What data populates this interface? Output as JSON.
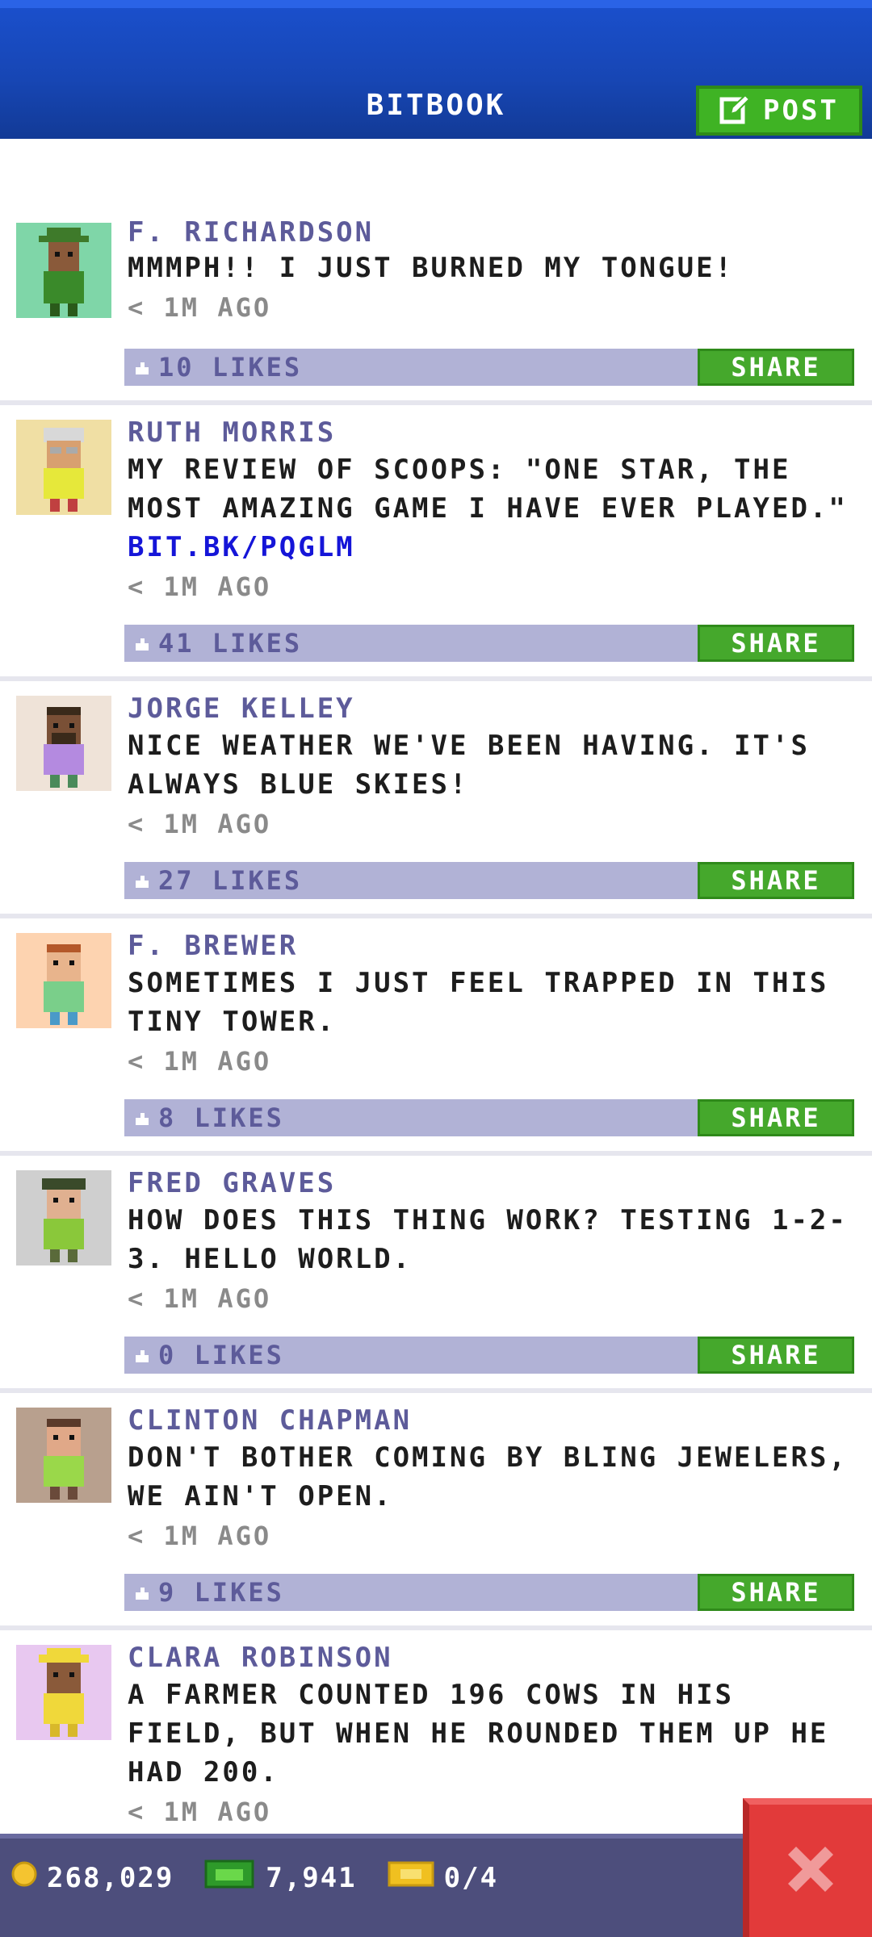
{
  "header": {
    "title": "BITBOOK",
    "post_label": "POST"
  },
  "posts": [
    {
      "name": "F. RICHARDSON",
      "message": "MMMPH!! I JUST BURNED MY TONGUE!",
      "link": "",
      "time": "< 1M AGO",
      "likes": "10 LIKES",
      "share": "SHARE",
      "avatar_bg": "#7fd6a8",
      "skin": "#8a5a3a",
      "shirt": "#3a8a2a",
      "hat": "#3e7a2a"
    },
    {
      "name": "RUTH MORRIS",
      "message": "MY REVIEW OF SCOOPS: \"ONE STAR, THE MOST AMAZING GAME I HAVE EVER PLAYED.\"",
      "link": "BIT.BK/PQGLM",
      "time": "< 1M AGO",
      "likes": "41 LIKES",
      "share": "SHARE",
      "avatar_bg": "#f0dfa4",
      "skin": "#d8a070",
      "shirt": "#e6e83a",
      "hat": "#d8d8d8"
    },
    {
      "name": "JORGE KELLEY",
      "message": "NICE WEATHER WE'VE BEEN HAVING. IT'S ALWAYS BLUE SKIES!",
      "link": "",
      "time": "< 1M AGO",
      "likes": "27 LIKES",
      "share": "SHARE",
      "avatar_bg": "#efe3d8",
      "skin": "#7a5036",
      "shirt": "#b48ae0",
      "hat": "#3a2a1a"
    },
    {
      "name": "F. BREWER",
      "message": "SOMETIMES I JUST FEEL TRAPPED IN THIS TINY TOWER.",
      "link": "",
      "time": "< 1M AGO",
      "likes": "8 LIKES",
      "share": "SHARE",
      "avatar_bg": "#fdd3b0",
      "skin": "#e8b48c",
      "shirt": "#7acf8a",
      "hat": "#b4582a"
    },
    {
      "name": "FRED GRAVES",
      "message": "HOW DOES THIS THING WORK? TESTING 1-2-3. HELLO WORLD.",
      "link": "",
      "time": "< 1M AGO",
      "likes": "0 LIKES",
      "share": "SHARE",
      "avatar_bg": "#cfcfcf",
      "skin": "#e0b090",
      "shirt": "#8ac83a",
      "hat": "#3a4a2a"
    },
    {
      "name": "CLINTON CHAPMAN",
      "message": "DON'T BOTHER COMING BY BLING JEWELERS, WE AIN'T OPEN.",
      "link": "",
      "time": "< 1M AGO",
      "likes": "9 LIKES",
      "share": "SHARE",
      "avatar_bg": "#b8a08e",
      "skin": "#e0a888",
      "shirt": "#9ad84a",
      "hat": "#5a3a2a"
    },
    {
      "name": "CLARA ROBINSON",
      "message": "A FARMER COUNTED 196 COWS IN HIS FIELD, BUT WHEN HE ROUNDED THEM UP HE HAD 200.",
      "link": "",
      "time": "< 1M AGO",
      "likes": "",
      "share": "",
      "avatar_bg": "#e8c8f0",
      "skin": "#8a5a3a",
      "shirt": "#f0d83a",
      "hat": "#f0d83a"
    }
  ],
  "status": {
    "coins": "268,029",
    "bux": "7,941",
    "tickets": "0/4"
  },
  "colors": {
    "header_blue": "#1746b4",
    "post_green": "#3fb324",
    "like_bar": "#b1b2d6",
    "name_purple": "#5d5b9a",
    "link_blue": "#1515d8",
    "close_red": "#e23a3a"
  }
}
